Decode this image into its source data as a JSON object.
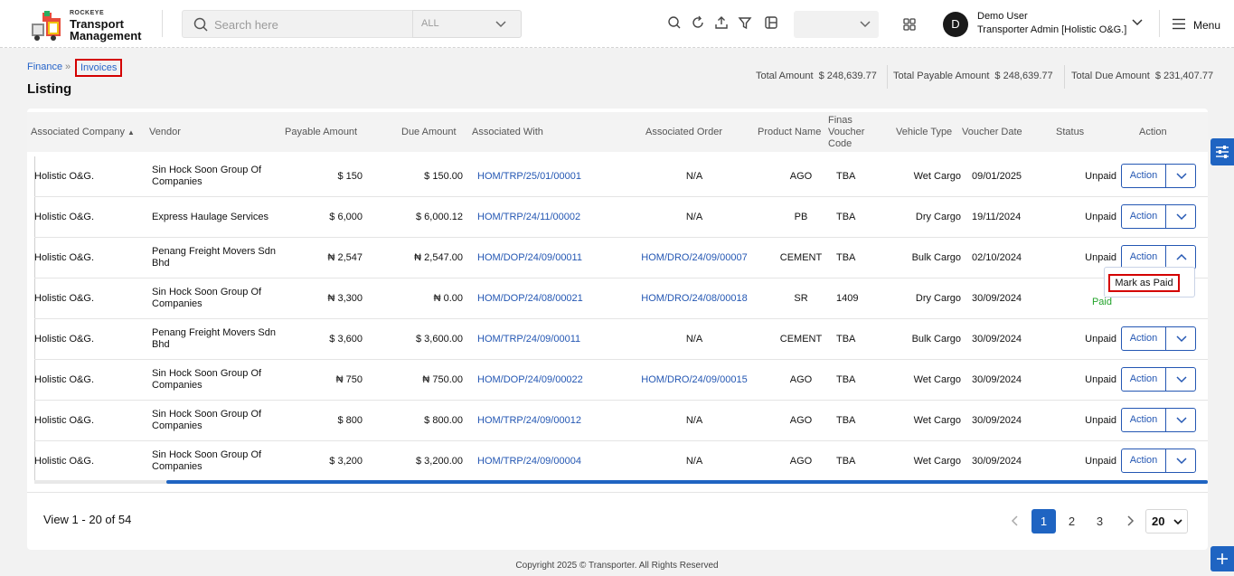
{
  "app": {
    "brand": "ROCKEYE",
    "title_line1": "Transport",
    "title_line2": "Management"
  },
  "search": {
    "placeholder": "Search here",
    "scope": "ALL"
  },
  "header_icons": [
    "search-icon",
    "refresh-icon",
    "upload-icon",
    "filter-icon",
    "layout-icon",
    "apps-icon"
  ],
  "user": {
    "initial": "D",
    "name": "Demo User",
    "role": "Transporter Admin [Holistic O&G.]"
  },
  "menu": {
    "label": "Menu"
  },
  "breadcrumb": {
    "parent": "Finance",
    "separator": "»",
    "current": "Invoices"
  },
  "page": {
    "title": "Listing"
  },
  "totals": {
    "total_label": "Total Amount",
    "total_value": "$ 248,639.77",
    "payable_label": "Total Payable Amount",
    "payable_value": "$ 248,639.77",
    "due_label": "Total Due Amount",
    "due_value": "$ 231,407.77"
  },
  "table": {
    "headers": {
      "company": "Associated Company",
      "vendor": "Vendor",
      "payable": "Payable Amount",
      "due": "Due Amount",
      "with": "Associated With",
      "order": "Associated Order",
      "product": "Product Name",
      "finas_1": "Finas",
      "finas_2": "Voucher",
      "finas_3": "Code",
      "vehicle": "Vehicle Type",
      "date": "Voucher Date",
      "status": "Status",
      "action": "Action"
    },
    "rows": [
      {
        "company": "Holistic O&G.",
        "vendor1": "Sin Hock Soon Group Of",
        "vendor2": "Companies",
        "payable": "$ 150",
        "due": "$ 150.00",
        "with": "HOM/TRP/25/01/00001",
        "order": "N/A",
        "product": "AGO",
        "finas": "TBA",
        "vehicle": "Wet Cargo",
        "date": "09/01/2025",
        "status": "Unpaid",
        "action": "Action"
      },
      {
        "company": "Holistic O&G.",
        "vendor1": "Express Haulage Services",
        "vendor2": "",
        "payable": "$ 6,000",
        "due": "$ 6,000.12",
        "with": "HOM/TRP/24/11/00002",
        "order": "N/A",
        "product": "PB",
        "finas": "TBA",
        "vehicle": "Dry Cargo",
        "date": "19/11/2024",
        "status": "Unpaid",
        "action": "Action"
      },
      {
        "company": "Holistic O&G.",
        "vendor1": "Penang Freight Movers Sdn",
        "vendor2": "Bhd",
        "payable": "₦ 2,547",
        "due": "₦ 2,547.00",
        "with": "HOM/DOP/24/09/00011",
        "order": "HOM/DRO/24/09/00007",
        "product": "CEMENT",
        "finas": "TBA",
        "vehicle": "Bulk Cargo",
        "date": "02/10/2024",
        "status": "Unpaid",
        "action": "Action"
      },
      {
        "company": "Holistic O&G.",
        "vendor1": "Sin Hock Soon Group Of",
        "vendor2": "Companies",
        "payable": "₦ 3,300",
        "due": "₦ 0.00",
        "with": "HOM/DOP/24/08/00021",
        "order": "HOM/DRO/24/08/00018",
        "product": "SR",
        "finas": "1409",
        "vehicle": "Dry Cargo",
        "date": "30/09/2024",
        "status": "Paid",
        "action": ""
      },
      {
        "company": "Holistic O&G.",
        "vendor1": "Penang Freight Movers Sdn",
        "vendor2": "Bhd",
        "payable": "$ 3,600",
        "due": "$ 3,600.00",
        "with": "HOM/TRP/24/09/00011",
        "order": "N/A",
        "product": "CEMENT",
        "finas": "TBA",
        "vehicle": "Bulk Cargo",
        "date": "30/09/2024",
        "status": "Unpaid",
        "action": "Action"
      },
      {
        "company": "Holistic O&G.",
        "vendor1": "Sin Hock Soon Group Of",
        "vendor2": "Companies",
        "payable": "₦ 750",
        "due": "₦ 750.00",
        "with": "HOM/DOP/24/09/00022",
        "order": "HOM/DRO/24/09/00015",
        "product": "AGO",
        "finas": "TBA",
        "vehicle": "Wet Cargo",
        "date": "30/09/2024",
        "status": "Unpaid",
        "action": "Action"
      },
      {
        "company": "Holistic O&G.",
        "vendor1": "Sin Hock Soon Group Of",
        "vendor2": "Companies",
        "payable": "$ 800",
        "due": "$ 800.00",
        "with": "HOM/TRP/24/09/00012",
        "order": "N/A",
        "product": "AGO",
        "finas": "TBA",
        "vehicle": "Wet Cargo",
        "date": "30/09/2024",
        "status": "Unpaid",
        "action": "Action"
      },
      {
        "company": "Holistic O&G.",
        "vendor1": "Sin Hock Soon Group Of",
        "vendor2": "Companies",
        "payable": "$ 3,200",
        "due": "$ 3,200.00",
        "with": "HOM/TRP/24/09/00004",
        "order": "N/A",
        "product": "AGO",
        "finas": "TBA",
        "vehicle": "Wet Cargo",
        "date": "30/09/2024",
        "status": "Unpaid",
        "action": "Action"
      }
    ]
  },
  "dropdown": {
    "mark_paid": "Mark as Paid"
  },
  "pagination": {
    "info": "View 1 - 20 of 54",
    "pages": [
      "1",
      "2",
      "3"
    ],
    "current": "1",
    "per_page": "20"
  },
  "footer": {
    "text": "Copyright 2025 © Transporter. All Rights Reserved"
  },
  "colors": {
    "accent": "#1f64c2",
    "link": "#2457b3",
    "highlight": "#d40000",
    "paid": "#22a32a"
  }
}
